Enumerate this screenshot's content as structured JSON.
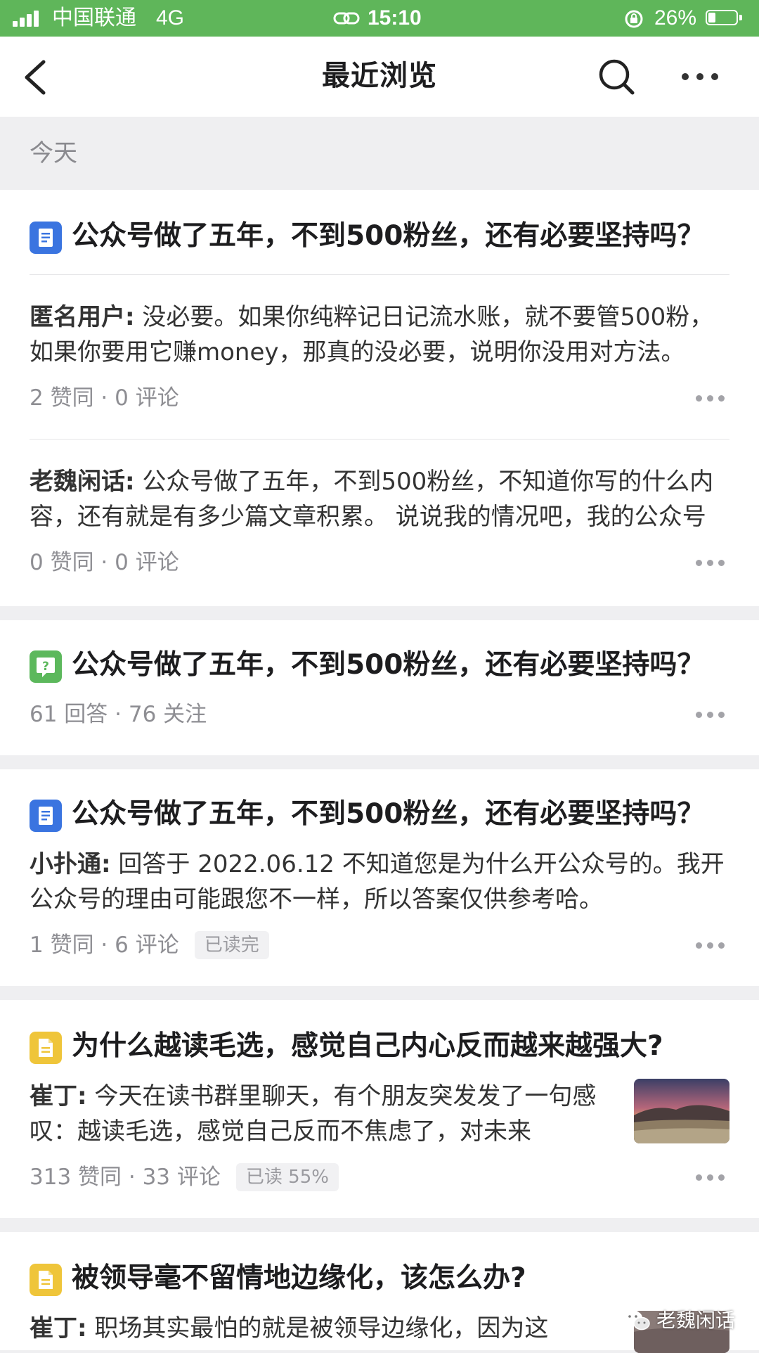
{
  "status_bar": {
    "carrier": "中国联通",
    "network": "4G",
    "time": "15:10",
    "battery_percent": "26%",
    "battery_level": 0.26
  },
  "nav": {
    "title": "最近浏览",
    "back_icon": "chevron-left-icon",
    "search_icon": "search-icon",
    "more_icon": "more-dots-icon"
  },
  "section": {
    "label": "今天"
  },
  "cards": [
    {
      "type": "article",
      "icon": "document-icon",
      "icon_color": "#3a74e0",
      "title": "公众号做了五年，不到500粉丝，还有必要坚持吗？",
      "answers": [
        {
          "author": "匿名用户:",
          "text": " 没必要。如果你纯粹记日记流水账，就不要管500粉，如果你要用它赚money，那真的没必要，说明你没用对方法。",
          "meta": "2 赞同 · 0 评论"
        },
        {
          "author": "老魏闲话:",
          "text": " 公众号做了五年，不到500粉丝，不知道你写的什么内容，还有就是有多少篇文章积累。 说说我的情况吧，我的公众号",
          "meta": "0 赞同 · 0 评论"
        }
      ]
    },
    {
      "type": "question",
      "icon": "question-icon",
      "icon_color": "#5cb85c",
      "title": "公众号做了五年，不到500粉丝，还有必要坚持吗？",
      "meta": "61 回答 · 76 关注"
    },
    {
      "type": "article",
      "icon": "document-icon",
      "icon_color": "#3a74e0",
      "title": "公众号做了五年，不到500粉丝，还有必要坚持吗？",
      "author": "小扑通:",
      "text": " 回答于 2022.06.12 不知道您是为什么开公众号的。我开公众号的理由可能跟您不一样，所以答案仅供参考哈。",
      "meta": "1 赞同 · 6 评论",
      "read_tag": "已读完"
    },
    {
      "type": "article",
      "icon": "note-icon",
      "icon_color": "#efc53a",
      "title": "为什么越读毛选，感觉自己内心反而越来越强大?",
      "author": "崔丁:",
      "text": " 今天在读书群里聊天，有个朋友突发发了一句感叹：越读毛选，感觉自己反而不焦虑了，对未来",
      "meta": "313 赞同 · 33 评论",
      "read_tag": "已读 55%",
      "thumbnail": "sunset-landscape-image"
    },
    {
      "type": "article",
      "icon": "note-icon",
      "icon_color": "#efc53a",
      "title": "被领导毫不留情地边缘化，该怎么办?",
      "author": "崔丁:",
      "text": " 职场其实最怕的就是被领导边缘化，因为这"
    }
  ],
  "watermark": {
    "text": "老魏闲话",
    "icon": "wechat-icon"
  }
}
